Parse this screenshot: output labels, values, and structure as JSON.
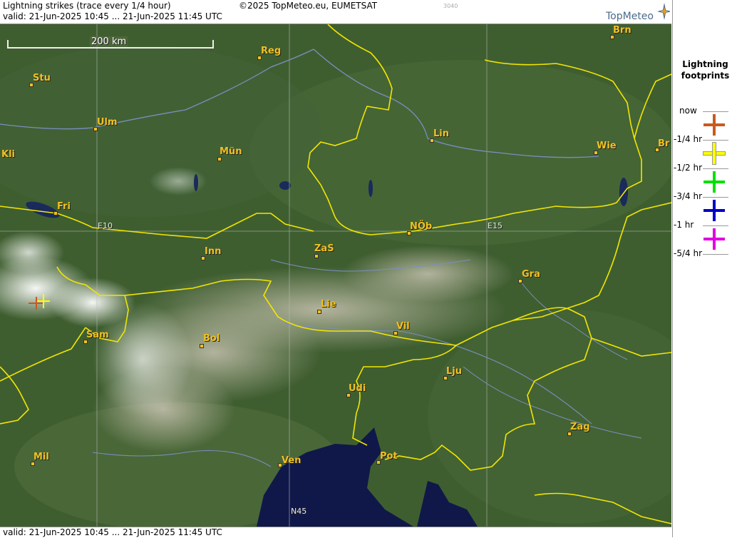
{
  "header": {
    "title": "Lightning strikes (trace every 1/4 hour)",
    "valid": "valid:  21-Jun-2025 10:45 ... 21-Jun-2025 11:45 UTC",
    "copyright": "©2025 TopMeteo.eu, EUMETSAT",
    "code": "3040",
    "logo_text": "TopMeteo"
  },
  "footer": {
    "valid": "valid:  21-Jun-2025 10:45 ... 21-Jun-2025 11:45 UTC"
  },
  "map": {
    "scale_label": "200 km",
    "grid_labels": [
      "E10",
      "E15",
      "N45"
    ],
    "cities": [
      "Brn",
      "Reg",
      "Stu",
      "Ulm",
      "Lin",
      "Mün",
      "Wie",
      "Br",
      "Kli",
      "Fri",
      "NÖb",
      "Inn",
      "ZaS",
      "Gra",
      "Lie",
      "Vil",
      "Sam",
      "Bol",
      "Lju",
      "Udi",
      "Zag",
      "Mil",
      "Ven",
      "Pot"
    ]
  },
  "legend": {
    "title": "Lightning footprints",
    "items": [
      {
        "label": "now",
        "color": "#c85a1e"
      },
      {
        "label": "-1/4 hr",
        "color": "#ffff00"
      },
      {
        "label": "-1/2 hr",
        "color": "#00e000"
      },
      {
        "label": "-3/4 hr",
        "color": "#0000c8"
      },
      {
        "label": "-1 hr",
        "color": "#e000e0"
      },
      {
        "label": "-5/4 hr",
        "color": ""
      }
    ]
  },
  "colors": {
    "border": "#f2e600",
    "land": "#3d5a2e",
    "sea": "#10184a",
    "rivers": "#7a8ec0",
    "city_label": "#f0c020"
  }
}
